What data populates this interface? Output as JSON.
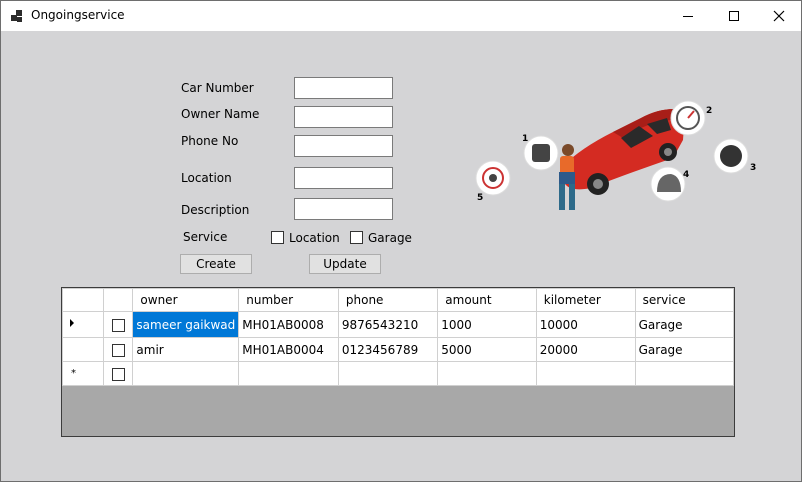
{
  "window": {
    "title": "Ongoingservice"
  },
  "form": {
    "car_number_label": "Car Number",
    "owner_name_label": "Owner Name",
    "phone_label": "Phone No",
    "location_label": "Location",
    "description_label": "Description",
    "service_label": "Service",
    "option_location": "Location",
    "option_garage": "Garage",
    "create_label": "Create",
    "update_label": "Update"
  },
  "illustration": {
    "callouts": [
      "1",
      "2",
      "3",
      "4",
      "5"
    ]
  },
  "grid": {
    "columns": [
      "owner",
      "number",
      "phone",
      "amount",
      "kilometer",
      "service"
    ],
    "rows": [
      {
        "owner": "sameer gaikwad",
        "number": "MH01AB0008",
        "phone": "9876543210",
        "amount": "1000",
        "kilometer": "10000",
        "service": "Garage"
      },
      {
        "owner": "amir",
        "number": "MH01AB0004",
        "phone": "0123456789",
        "amount": "5000",
        "kilometer": "20000",
        "service": "Garage"
      }
    ],
    "new_row_marker": "*"
  }
}
